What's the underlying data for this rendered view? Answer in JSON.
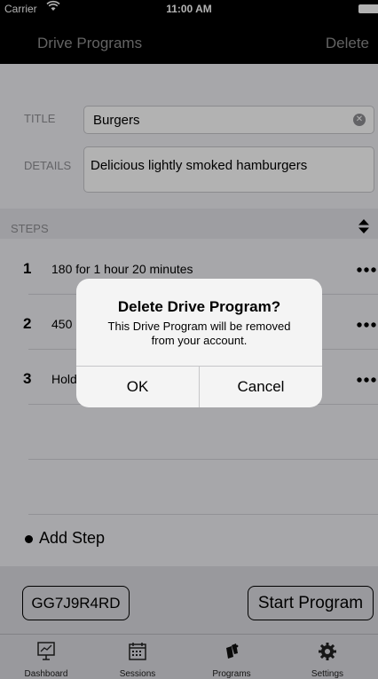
{
  "status": {
    "carrier": "Carrier",
    "time": "11:00 AM"
  },
  "nav": {
    "title": "Drive Programs",
    "delete": "Delete"
  },
  "form": {
    "title_label": "TITLE",
    "title_value": "Burgers",
    "details_label": "DETAILS",
    "details_value": "Delicious lightly smoked hamburgers"
  },
  "steps": {
    "header": "STEPS",
    "items": [
      {
        "num": "1",
        "text": "180 for 1 hour 20 minutes"
      },
      {
        "num": "2",
        "text": "450"
      },
      {
        "num": "3",
        "text": "Hold"
      }
    ],
    "add_label": "Add Step"
  },
  "actions": {
    "code": "GG7J9R4RD",
    "start": "Start Program"
  },
  "tabs": [
    {
      "label": "Dashboard",
      "icon": "dashboard-icon"
    },
    {
      "label": "Sessions",
      "icon": "calendar-icon"
    },
    {
      "label": "Programs",
      "icon": "programs-icon"
    },
    {
      "label": "Settings",
      "icon": "gear-icon"
    }
  ],
  "alert": {
    "title": "Delete Drive Program?",
    "message_line1": "This Drive Program will be removed",
    "message_line2": "from your account.",
    "ok": "OK",
    "cancel": "Cancel"
  }
}
